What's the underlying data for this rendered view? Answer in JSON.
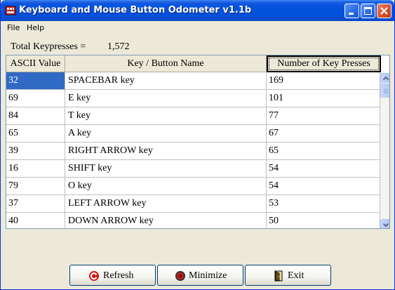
{
  "window": {
    "title": "Keyboard and Mouse Button Odometer v1.1b"
  },
  "menu": {
    "items": [
      "File",
      "Help"
    ]
  },
  "total": {
    "label": "Total Keypresses =",
    "value": "1,572"
  },
  "table": {
    "columns": [
      "ASCII Value",
      "Key / Button Name",
      "Number of Key Presses"
    ],
    "sorted_column": 2,
    "selected_row": 0,
    "rows": [
      [
        "32",
        "SPACEBAR key",
        "169"
      ],
      [
        "69",
        "E key",
        "101"
      ],
      [
        "84",
        "T key",
        "77"
      ],
      [
        "65",
        "A key",
        "67"
      ],
      [
        "39",
        "RIGHT ARROW key",
        "65"
      ],
      [
        "16",
        "SHIFT key",
        "54"
      ],
      [
        "79",
        "O key",
        "54"
      ],
      [
        "37",
        "LEFT ARROW key",
        "53"
      ],
      [
        "40",
        "DOWN ARROW key",
        "50"
      ]
    ]
  },
  "buttons": {
    "refresh": "Refresh",
    "minimize": "Minimize",
    "exit": "Exit"
  },
  "colors": {
    "titlebar": "#0352dc",
    "selection": "#316ac5",
    "close_button": "#d9502c"
  }
}
